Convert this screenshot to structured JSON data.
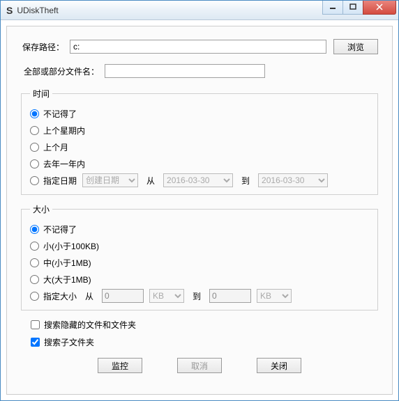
{
  "titlebar": {
    "icon": "S",
    "title": "UDiskTheft"
  },
  "savePath": {
    "label": "保存路径：",
    "value": "c:",
    "browse": "浏览"
  },
  "filename": {
    "label": "全部或部分文件名：",
    "value": ""
  },
  "time": {
    "legend": "时间",
    "options": {
      "dontRemember": "不记得了",
      "lastWeek": "上个星期内",
      "lastMonth": "上个月",
      "lastYear": "去年一年内",
      "specifyDate": "指定日期"
    },
    "dateType": "创建日期",
    "fromLabel": "从",
    "fromDate": "2016-03-30",
    "toLabel": "到",
    "toDate": "2016-03-30"
  },
  "size": {
    "legend": "大小",
    "options": {
      "dontRemember": "不记得了",
      "small": "小(小于100KB)",
      "medium": "中(小于1MB)",
      "large": "大(大于1MB)",
      "specify": "指定大小"
    },
    "fromLabel": "从",
    "fromVal": "0",
    "fromUnit": "KB",
    "toLabel": "到",
    "toVal": "0",
    "toUnit": "KB"
  },
  "checkboxes": {
    "searchHidden": "搜索隐藏的文件和文件夹",
    "searchSub": "搜索子文件夹"
  },
  "actions": {
    "monitor": "监控",
    "cancel": "取消",
    "close": "关闭"
  }
}
